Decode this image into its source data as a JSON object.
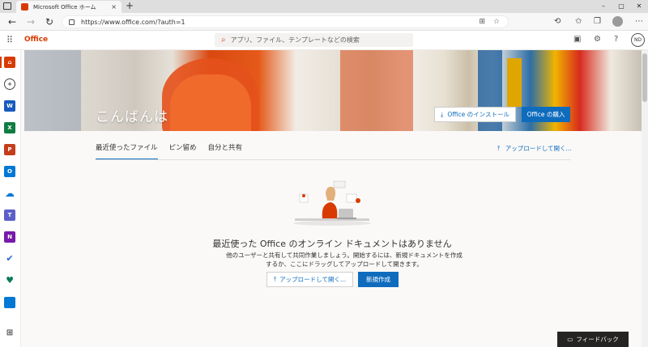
{
  "browser": {
    "tab_title": "Microsoft Office ホーム",
    "tab_close": "×",
    "new_tab": "+",
    "url": "https://www.office.com/?auth=1",
    "nav": {
      "back": "←",
      "forward": "→",
      "refresh": "↻"
    },
    "window": {
      "minimize": "–",
      "maximize": "▢",
      "close": "✕"
    }
  },
  "header": {
    "brand": "Office",
    "search_placeholder": "アプリ、ファイル、テンプレートなどの検索",
    "avatar_initials": "ND"
  },
  "banner": {
    "greeting": "こんばんは",
    "install_label": "Office のインストール",
    "buy_label": "Office の購入"
  },
  "tabs": [
    {
      "label": "最近使ったファイル",
      "active": true
    },
    {
      "label": "ピン留め",
      "active": false
    },
    {
      "label": "自分と共有",
      "active": false
    }
  ],
  "upload_link": "アップロードして開く...",
  "empty_state": {
    "title": "最近使った Office のオンライン ドキュメントはありません",
    "desc_line1": "他のユーザーと共有して共同作業しましょう。開始するには、新規ドキュメントを作成",
    "desc_line2": "するか、ここにドラッグしてアップロードして開きます。",
    "upload_button": "アップロードして開く...",
    "new_button": "新規作成"
  },
  "feedback": "フィードバック",
  "rail_apps": [
    {
      "name": "home",
      "color": "#d83b01"
    },
    {
      "name": "create",
      "color": "#605e5c"
    },
    {
      "name": "word",
      "color": "#185abd"
    },
    {
      "name": "excel",
      "color": "#107c41"
    },
    {
      "name": "powerpoint",
      "color": "#c43e1c"
    },
    {
      "name": "outlook",
      "color": "#0078d4"
    },
    {
      "name": "onedrive",
      "color": "#0078d4"
    },
    {
      "name": "teams",
      "color": "#5b5fc7"
    },
    {
      "name": "onenote",
      "color": "#7719aa"
    },
    {
      "name": "todo",
      "color": "#2564cf"
    },
    {
      "name": "family-safety",
      "color": "#0a7a5a"
    },
    {
      "name": "calendar",
      "color": "#0078d4"
    },
    {
      "name": "all-apps",
      "color": "#605e5c"
    }
  ],
  "colors": {
    "accent": "#0f6cbd",
    "brand": "#d83b01"
  }
}
